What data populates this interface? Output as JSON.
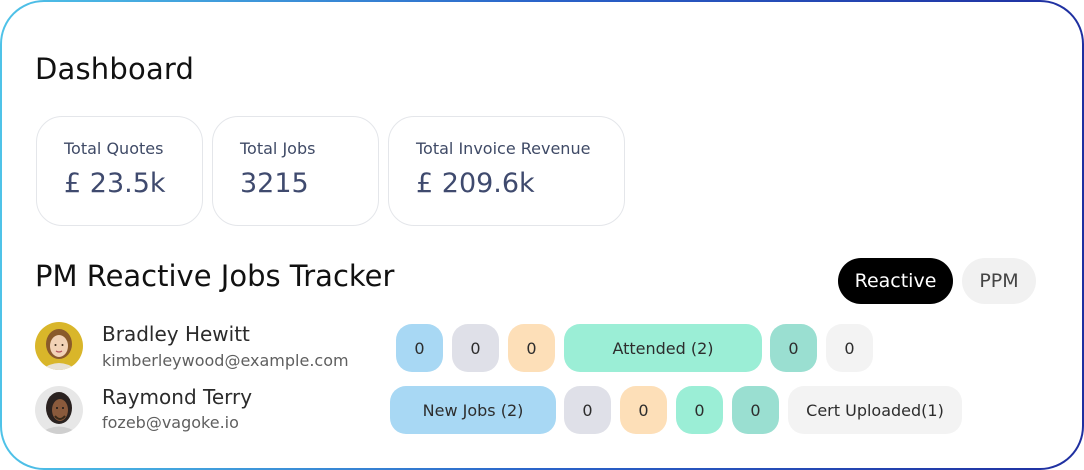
{
  "dashboard": {
    "title": "Dashboard"
  },
  "stats": [
    {
      "label": "Total Quotes",
      "value": "£ 23.5k"
    },
    {
      "label": "Total Jobs",
      "value": "3215"
    },
    {
      "label": "Total Invoice Revenue",
      "value": "£ 209.6k"
    }
  ],
  "tracker": {
    "title": "PM Reactive Jobs Tracker",
    "toggle": {
      "active": "Reactive",
      "inactive": "PPM"
    }
  },
  "people": [
    {
      "name": "Bradley Hewitt",
      "email": "kimberleywood@example.com",
      "pills": [
        "0",
        "0",
        "0",
        "Attended (2)",
        "0",
        "0"
      ]
    },
    {
      "name": "Raymond Terry",
      "email": "fozeb@vagoke.io",
      "pills": [
        "New Jobs (2)",
        "0",
        "0",
        "0",
        "0",
        "Cert Uploaded(1)"
      ]
    }
  ],
  "colors": {
    "blue": "#a8d8f4",
    "grey": "#dfe0e8",
    "peach": "#fddfb8",
    "mint": "#9beed6",
    "teal": "#9adfd1",
    "light": "#f3f3f3",
    "active_toggle": "#000000"
  }
}
